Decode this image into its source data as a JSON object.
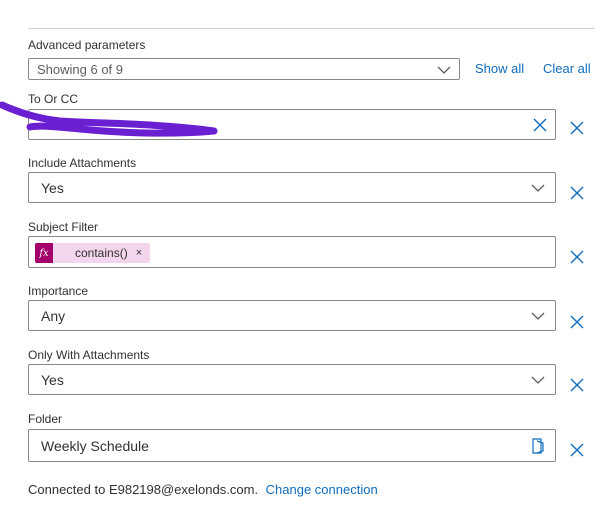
{
  "advanced": {
    "label": "Advanced parameters",
    "selected": "Showing 6 of 9",
    "show_all": "Show all",
    "clear_all": "Clear all"
  },
  "fields": {
    "to_or_cc": {
      "label": "To Or CC",
      "value": ""
    },
    "include_attachments": {
      "label": "Include Attachments",
      "value": "Yes"
    },
    "subject_filter": {
      "label": "Subject Filter",
      "token": "contains()",
      "token_remove": "×",
      "token_icon": "fx"
    },
    "importance": {
      "label": "Importance",
      "value": "Any"
    },
    "only_with_attachments": {
      "label": "Only With Attachments",
      "value": "Yes"
    },
    "folder": {
      "label": "Folder",
      "value": "Weekly Schedule"
    }
  },
  "footer": {
    "connected_text": "Connected to E982198@exelonds.com.",
    "change_link": "Change connection"
  },
  "colors": {
    "accent": "#0f6cbd",
    "redaction": "#6a1fd1",
    "fx_badge": "#a4006b",
    "token_bg": "#f3d6ee"
  }
}
